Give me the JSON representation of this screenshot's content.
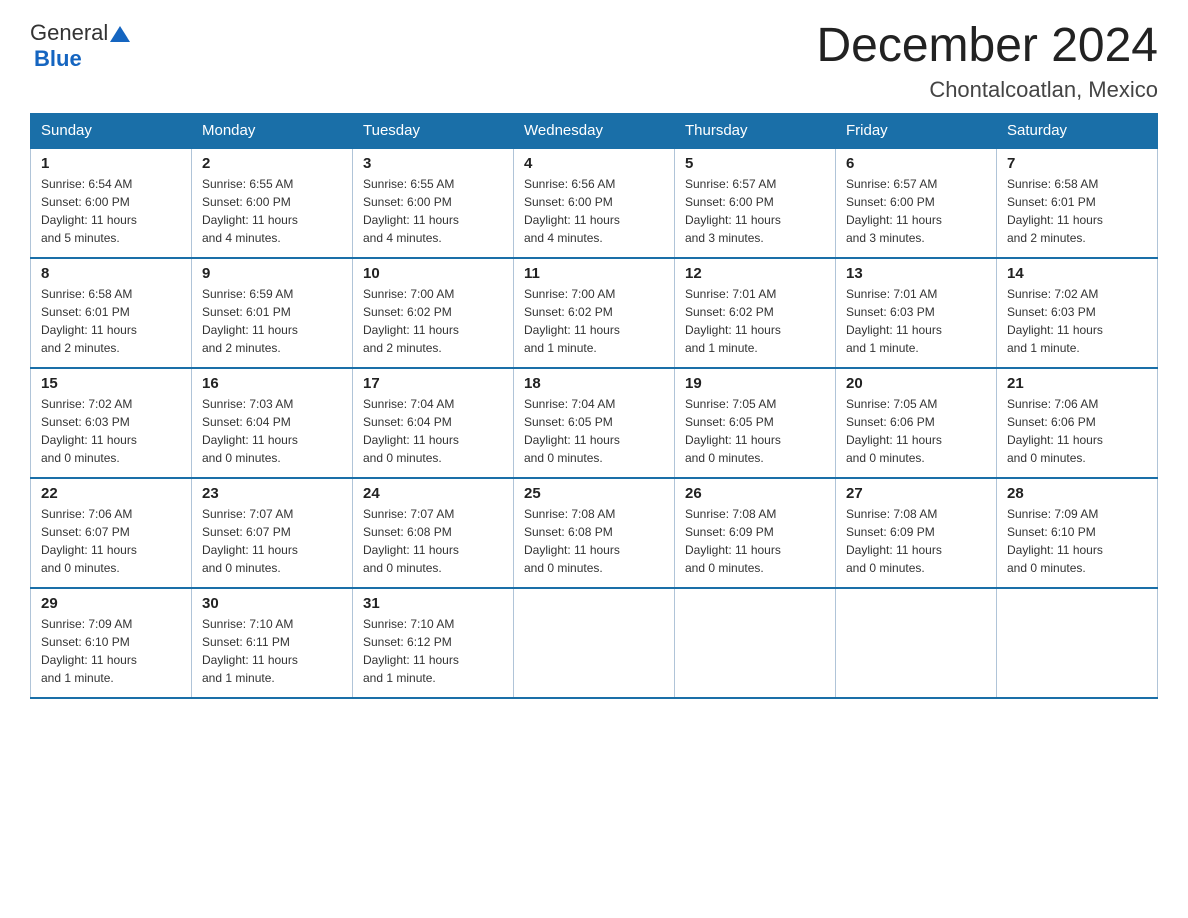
{
  "header": {
    "logo_general": "General",
    "logo_blue": "Blue",
    "month_year": "December 2024",
    "location": "Chontalcoatlan, Mexico"
  },
  "days_of_week": [
    "Sunday",
    "Monday",
    "Tuesday",
    "Wednesday",
    "Thursday",
    "Friday",
    "Saturday"
  ],
  "weeks": [
    [
      {
        "day": "1",
        "sunrise": "6:54 AM",
        "sunset": "6:00 PM",
        "daylight": "11 hours and 5 minutes."
      },
      {
        "day": "2",
        "sunrise": "6:55 AM",
        "sunset": "6:00 PM",
        "daylight": "11 hours and 4 minutes."
      },
      {
        "day": "3",
        "sunrise": "6:55 AM",
        "sunset": "6:00 PM",
        "daylight": "11 hours and 4 minutes."
      },
      {
        "day": "4",
        "sunrise": "6:56 AM",
        "sunset": "6:00 PM",
        "daylight": "11 hours and 4 minutes."
      },
      {
        "day": "5",
        "sunrise": "6:57 AM",
        "sunset": "6:00 PM",
        "daylight": "11 hours and 3 minutes."
      },
      {
        "day": "6",
        "sunrise": "6:57 AM",
        "sunset": "6:00 PM",
        "daylight": "11 hours and 3 minutes."
      },
      {
        "day": "7",
        "sunrise": "6:58 AM",
        "sunset": "6:01 PM",
        "daylight": "11 hours and 2 minutes."
      }
    ],
    [
      {
        "day": "8",
        "sunrise": "6:58 AM",
        "sunset": "6:01 PM",
        "daylight": "11 hours and 2 minutes."
      },
      {
        "day": "9",
        "sunrise": "6:59 AM",
        "sunset": "6:01 PM",
        "daylight": "11 hours and 2 minutes."
      },
      {
        "day": "10",
        "sunrise": "7:00 AM",
        "sunset": "6:02 PM",
        "daylight": "11 hours and 2 minutes."
      },
      {
        "day": "11",
        "sunrise": "7:00 AM",
        "sunset": "6:02 PM",
        "daylight": "11 hours and 1 minute."
      },
      {
        "day": "12",
        "sunrise": "7:01 AM",
        "sunset": "6:02 PM",
        "daylight": "11 hours and 1 minute."
      },
      {
        "day": "13",
        "sunrise": "7:01 AM",
        "sunset": "6:03 PM",
        "daylight": "11 hours and 1 minute."
      },
      {
        "day": "14",
        "sunrise": "7:02 AM",
        "sunset": "6:03 PM",
        "daylight": "11 hours and 1 minute."
      }
    ],
    [
      {
        "day": "15",
        "sunrise": "7:02 AM",
        "sunset": "6:03 PM",
        "daylight": "11 hours and 0 minutes."
      },
      {
        "day": "16",
        "sunrise": "7:03 AM",
        "sunset": "6:04 PM",
        "daylight": "11 hours and 0 minutes."
      },
      {
        "day": "17",
        "sunrise": "7:04 AM",
        "sunset": "6:04 PM",
        "daylight": "11 hours and 0 minutes."
      },
      {
        "day": "18",
        "sunrise": "7:04 AM",
        "sunset": "6:05 PM",
        "daylight": "11 hours and 0 minutes."
      },
      {
        "day": "19",
        "sunrise": "7:05 AM",
        "sunset": "6:05 PM",
        "daylight": "11 hours and 0 minutes."
      },
      {
        "day": "20",
        "sunrise": "7:05 AM",
        "sunset": "6:06 PM",
        "daylight": "11 hours and 0 minutes."
      },
      {
        "day": "21",
        "sunrise": "7:06 AM",
        "sunset": "6:06 PM",
        "daylight": "11 hours and 0 minutes."
      }
    ],
    [
      {
        "day": "22",
        "sunrise": "7:06 AM",
        "sunset": "6:07 PM",
        "daylight": "11 hours and 0 minutes."
      },
      {
        "day": "23",
        "sunrise": "7:07 AM",
        "sunset": "6:07 PM",
        "daylight": "11 hours and 0 minutes."
      },
      {
        "day": "24",
        "sunrise": "7:07 AM",
        "sunset": "6:08 PM",
        "daylight": "11 hours and 0 minutes."
      },
      {
        "day": "25",
        "sunrise": "7:08 AM",
        "sunset": "6:08 PM",
        "daylight": "11 hours and 0 minutes."
      },
      {
        "day": "26",
        "sunrise": "7:08 AM",
        "sunset": "6:09 PM",
        "daylight": "11 hours and 0 minutes."
      },
      {
        "day": "27",
        "sunrise": "7:08 AM",
        "sunset": "6:09 PM",
        "daylight": "11 hours and 0 minutes."
      },
      {
        "day": "28",
        "sunrise": "7:09 AM",
        "sunset": "6:10 PM",
        "daylight": "11 hours and 0 minutes."
      }
    ],
    [
      {
        "day": "29",
        "sunrise": "7:09 AM",
        "sunset": "6:10 PM",
        "daylight": "11 hours and 1 minute."
      },
      {
        "day": "30",
        "sunrise": "7:10 AM",
        "sunset": "6:11 PM",
        "daylight": "11 hours and 1 minute."
      },
      {
        "day": "31",
        "sunrise": "7:10 AM",
        "sunset": "6:12 PM",
        "daylight": "11 hours and 1 minute."
      },
      null,
      null,
      null,
      null
    ]
  ],
  "labels": {
    "sunrise": "Sunrise:",
    "sunset": "Sunset:",
    "daylight": "Daylight:"
  }
}
